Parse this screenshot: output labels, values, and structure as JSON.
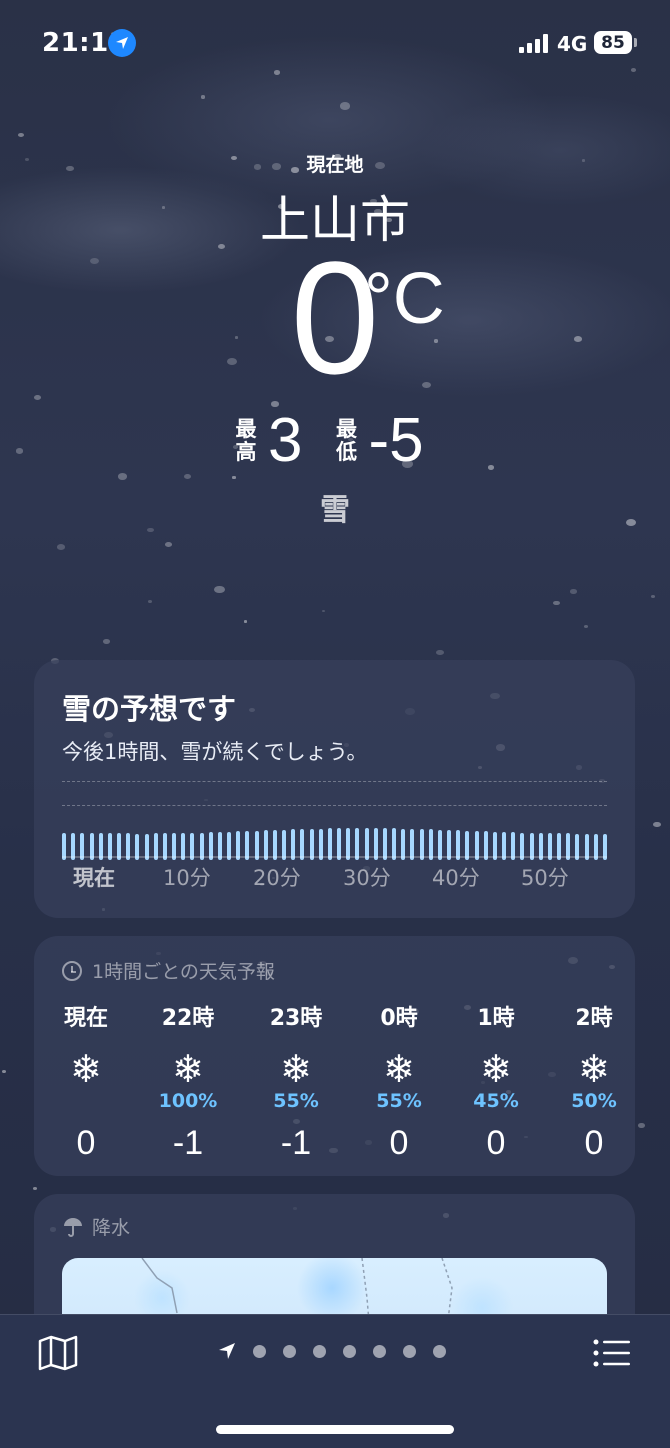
{
  "status_bar": {
    "time": "21:11",
    "network": "4G",
    "battery": "85"
  },
  "header": {
    "location_label": "現在地",
    "city": "上山市",
    "temperature": "0",
    "unit": "°C",
    "high_label": "最高",
    "high": "3",
    "low_label": "最低",
    "low": "-5",
    "condition": "雪"
  },
  "precip_card": {
    "title": "雪の予想です",
    "subtitle": "今後1時間、雪が続くでしょう。",
    "ticks": [
      "現在",
      "10分",
      "20分",
      "30分",
      "40分",
      "50分"
    ]
  },
  "hourly_card": {
    "title": "1時間ごとの天気予報",
    "hours": [
      {
        "time": "現在",
        "icon": "snowflake-icon",
        "pop": "",
        "temp": "0"
      },
      {
        "time": "22時",
        "icon": "snowflake-icon",
        "pop": "100%",
        "temp": "-1"
      },
      {
        "time": "23時",
        "icon": "snowflake-icon",
        "pop": "55%",
        "temp": "-1"
      },
      {
        "time": "0時",
        "icon": "snowflake-icon",
        "pop": "55%",
        "temp": "0"
      },
      {
        "time": "1時",
        "icon": "snowflake-icon",
        "pop": "45%",
        "temp": "0"
      },
      {
        "time": "2時",
        "icon": "snowflake-icon",
        "pop": "50%",
        "temp": "0"
      }
    ]
  },
  "precipitation_card": {
    "title": "降水"
  },
  "colors": {
    "accent": "#1e88ff",
    "pop": "#6ec3ff",
    "bars": "#a7d8ff"
  },
  "icons": [
    "location-arrow-icon",
    "signal-icon",
    "battery-icon",
    "clock-icon",
    "umbrella-icon",
    "map-icon",
    "list-icon",
    "snowflake-icon"
  ]
}
